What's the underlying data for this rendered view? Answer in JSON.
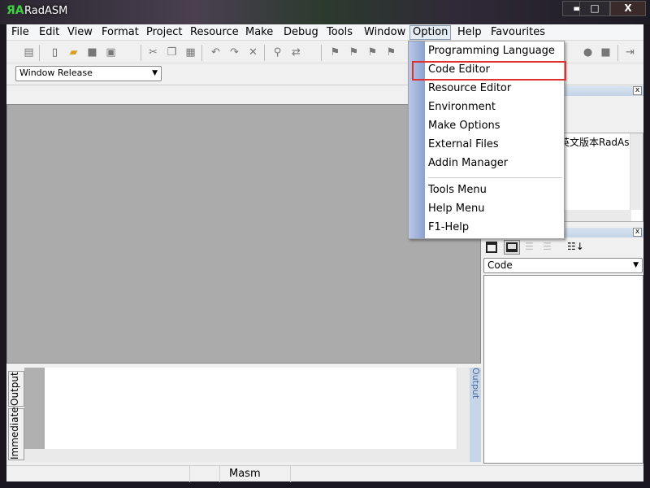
{
  "window": {
    "title": "RadASM",
    "controls": [
      "minimize",
      "maximize",
      "close"
    ]
  },
  "menubar": [
    "File",
    "Edit",
    "View",
    "Format",
    "Project",
    "Resource",
    "Make",
    "Debug",
    "Tools",
    "Window",
    "Option",
    "Help",
    "Favourites"
  ],
  "open_menu": "Option",
  "option_menu": {
    "items": [
      "Programming Language",
      "Code Editor",
      "Resource Editor",
      "Environment",
      "Make Options",
      "External Files",
      "Addin Manager",
      "Tools Menu",
      "Help Menu",
      "F1-Help"
    ],
    "highlighted": "Code Editor",
    "highlight_color": "#e03030"
  },
  "build_combo": {
    "value": "Window Release"
  },
  "project_tree": {
    "item": "英文版本RadAs"
  },
  "properties": {
    "combo_value": "Code"
  },
  "output": {
    "tabs": [
      "Output",
      "Immediate"
    ],
    "caption": "Output"
  },
  "statusbar": {
    "language": "Masm"
  }
}
